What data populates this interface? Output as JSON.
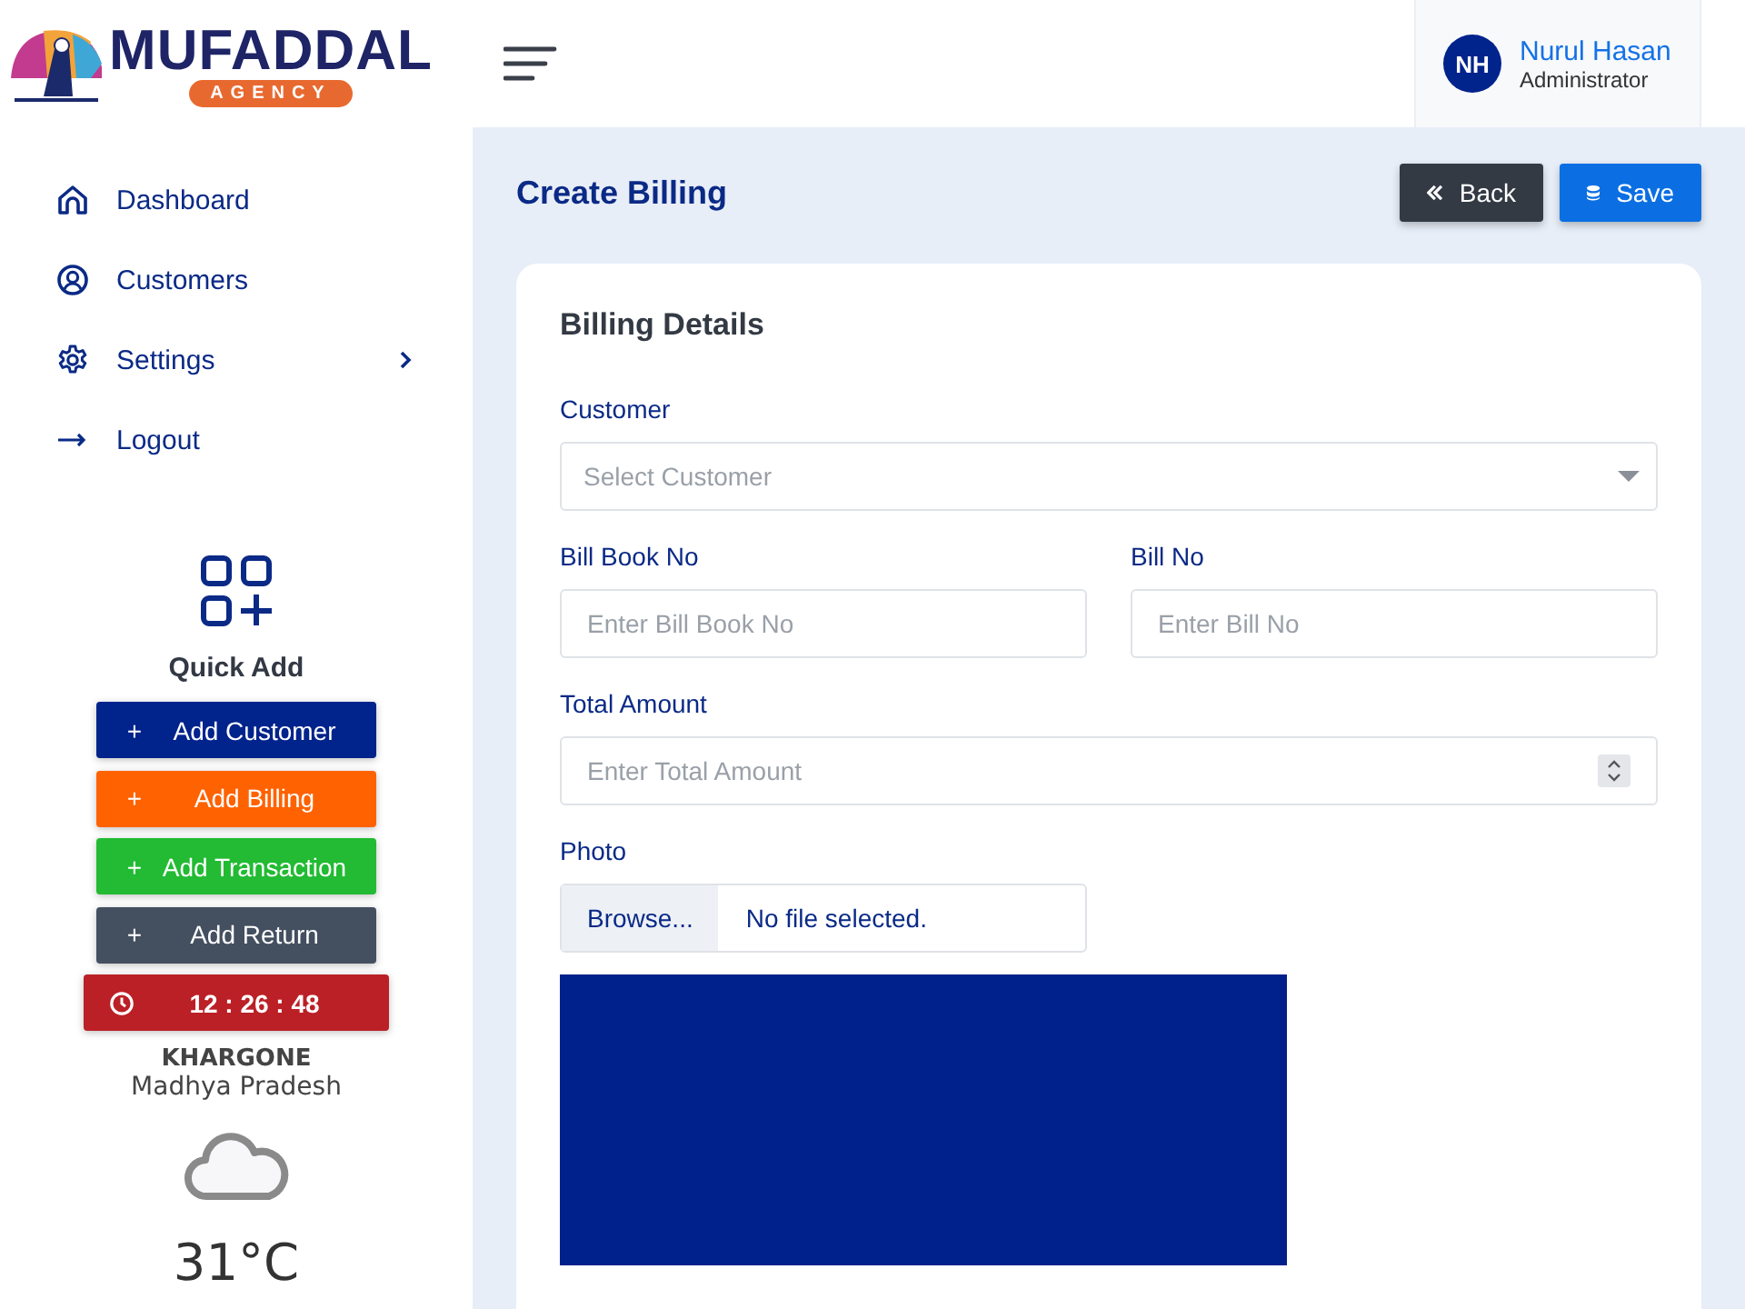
{
  "brand": {
    "name": "MUFADDAL",
    "tagline": "AGENCY"
  },
  "sidebar": {
    "items": [
      {
        "label": "Dashboard",
        "has_submenu": false
      },
      {
        "label": "Customers",
        "has_submenu": false
      },
      {
        "label": "Settings",
        "has_submenu": true
      },
      {
        "label": "Logout",
        "has_submenu": false
      }
    ]
  },
  "quick_add": {
    "title": "Quick Add",
    "buttons": [
      {
        "label": "+",
        "text": "Add Customer",
        "color": "#00238c"
      },
      {
        "label": "+",
        "text": "Add Billing",
        "color": "#ff6200"
      },
      {
        "label": "+",
        "text": "Add Transaction",
        "color": "#22bb33"
      },
      {
        "label": "+",
        "text": "Add Return",
        "color": "#444f60"
      }
    ],
    "clock": {
      "time": "12 : 26 : 48",
      "color": "#bb2026"
    }
  },
  "weather": {
    "city": "KHARGONE",
    "region": "Madhya Pradesh",
    "temperature": "31°C"
  },
  "user": {
    "initials": "NH",
    "name": "Nurul Hasan",
    "role": "Administrator"
  },
  "page": {
    "title": "Create Billing",
    "buttons": [
      {
        "label": "Back",
        "kind": "back"
      },
      {
        "label": "Save",
        "kind": "save"
      }
    ]
  },
  "form": {
    "title": "Billing Details",
    "customer": {
      "label": "Customer",
      "placeholder": "Select Customer"
    },
    "bill_book_no": {
      "label": "Bill Book No",
      "placeholder": "Enter Bill Book No"
    },
    "bill_no": {
      "label": "Bill No",
      "placeholder": "Enter Bill No"
    },
    "total_amount": {
      "label": "Total Amount",
      "placeholder": "Enter Total Amount"
    },
    "photo": {
      "label": "Photo",
      "button": "Browse...",
      "status": "No file selected."
    }
  }
}
